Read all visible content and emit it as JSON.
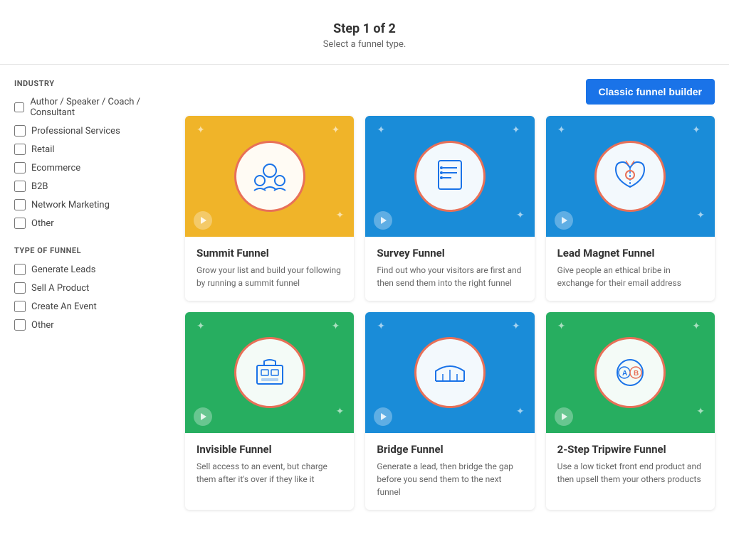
{
  "header": {
    "step": "Step 1 of 2",
    "subtitle": "Select a funnel type."
  },
  "sidebar": {
    "industry_label": "INDUSTRY",
    "industry_items": [
      {
        "label": "Author / Speaker / Coach / Consultant",
        "checked": false
      },
      {
        "label": "Professional Services",
        "checked": false
      },
      {
        "label": "Retail",
        "checked": false
      },
      {
        "label": "Ecommerce",
        "checked": false
      },
      {
        "label": "B2B",
        "checked": false
      },
      {
        "label": "Network Marketing",
        "checked": false
      },
      {
        "label": "Other",
        "checked": false
      }
    ],
    "funnel_type_label": "TYPE OF FUNNEL",
    "funnel_type_items": [
      {
        "label": "Generate Leads",
        "checked": false
      },
      {
        "label": "Sell A Product",
        "checked": false
      },
      {
        "label": "Create An Event",
        "checked": false
      },
      {
        "label": "Other",
        "checked": false
      }
    ]
  },
  "main": {
    "classic_button": "Classic funnel builder",
    "funnels": [
      {
        "title": "Summit Funnel",
        "description": "Grow your list and build your following by running a summit funnel",
        "bg_class": "bg-yellow",
        "icon_type": "summit"
      },
      {
        "title": "Survey Funnel",
        "description": "Find out who your visitors are first and then send them into the right funnel",
        "bg_class": "bg-blue",
        "icon_type": "survey"
      },
      {
        "title": "Lead Magnet Funnel",
        "description": "Give people an ethical bribe in exchange for their email address",
        "bg_class": "bg-blue2",
        "icon_type": "leadmagnet"
      },
      {
        "title": "Invisible Funnel",
        "description": "Sell access to an event, but charge them after it's over if they like it",
        "bg_class": "bg-green",
        "icon_type": "invisible"
      },
      {
        "title": "Bridge Funnel",
        "description": "Generate a lead, then bridge the gap before you send them to the next funnel",
        "bg_class": "bg-green2",
        "icon_type": "bridge"
      },
      {
        "title": "2-Step Tripwire Funnel",
        "description": "Use a low ticket front end product and then upsell them your others products",
        "bg_class": "bg-green3",
        "icon_type": "tripwire"
      }
    ]
  }
}
